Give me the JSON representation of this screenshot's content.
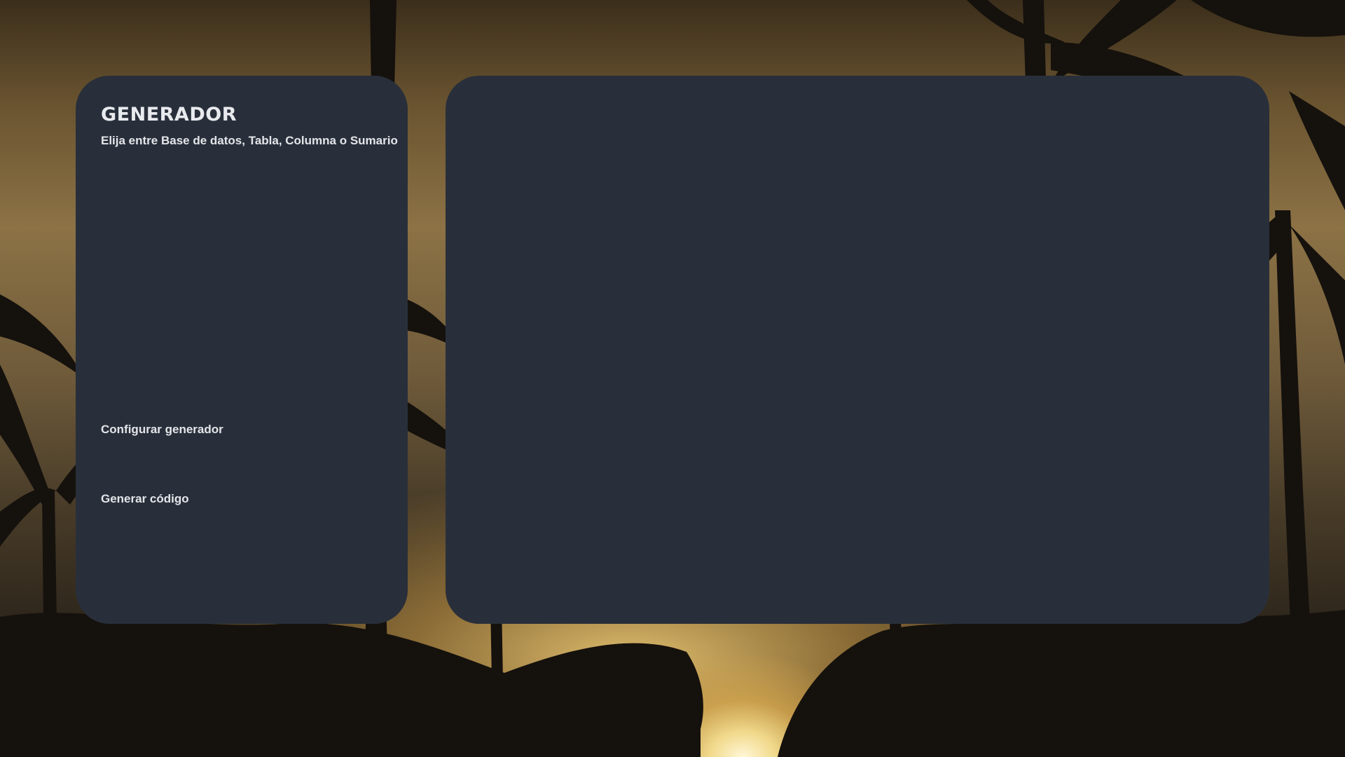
{
  "generator_panel": {
    "title": "GENERADOR",
    "subtitle": "Elija entre Base de datos, Tabla, Columna o Sumario",
    "configure_label": "Configurar generador",
    "generate_label": "Generar código"
  },
  "output_panel": {},
  "colors": {
    "panel_background": "#292f3a",
    "text": "#e3e5e9"
  },
  "wallpaper": {
    "description_icon": "palm-trees-sunset-wallpaper"
  }
}
